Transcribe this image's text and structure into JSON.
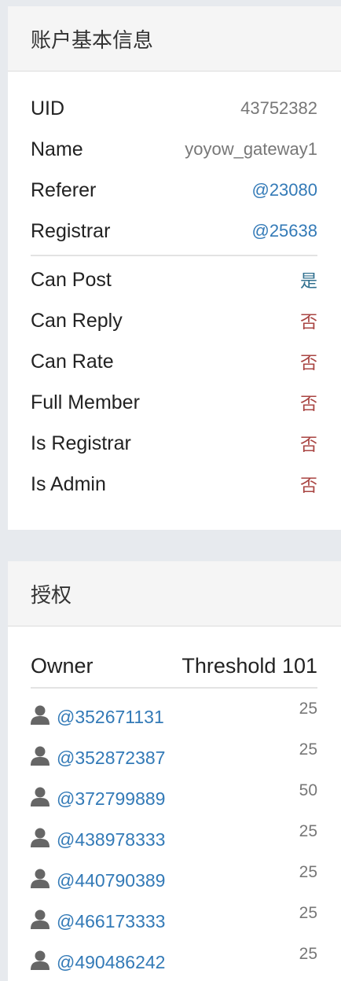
{
  "account_panel": {
    "title": "账户基本信息",
    "rows": [
      {
        "label": "UID",
        "value": "43752382"
      },
      {
        "label": "Name",
        "value": "yoyow_gateway1"
      },
      {
        "label": "Referer",
        "value": "@23080"
      },
      {
        "label": "Registrar",
        "value": "@25638"
      }
    ],
    "flags": [
      {
        "label": "Can Post",
        "value": "是"
      },
      {
        "label": "Can Reply",
        "value": "否"
      },
      {
        "label": "Can Rate",
        "value": "否"
      },
      {
        "label": "Full Member",
        "value": "否"
      },
      {
        "label": "Is Registrar",
        "value": "否"
      },
      {
        "label": "Is Admin",
        "value": "否"
      }
    ]
  },
  "auth_panel": {
    "title": "授权",
    "owner_label": "Owner",
    "threshold_label": "Threshold 101",
    "entries": [
      {
        "account": "@352671131",
        "weight": "25"
      },
      {
        "account": "@352872387",
        "weight": "25"
      },
      {
        "account": "@372799889",
        "weight": "50"
      },
      {
        "account": "@438978333",
        "weight": "25"
      },
      {
        "account": "@440790389",
        "weight": "25"
      },
      {
        "account": "@466173333",
        "weight": "25"
      },
      {
        "account": "@490486242",
        "weight": "25"
      }
    ]
  },
  "icons": {
    "entry_icon": "user-icon"
  },
  "colors": {
    "link": "#337ab7",
    "yes": "#31708f",
    "no": "#a94442",
    "muted": "#777777"
  }
}
